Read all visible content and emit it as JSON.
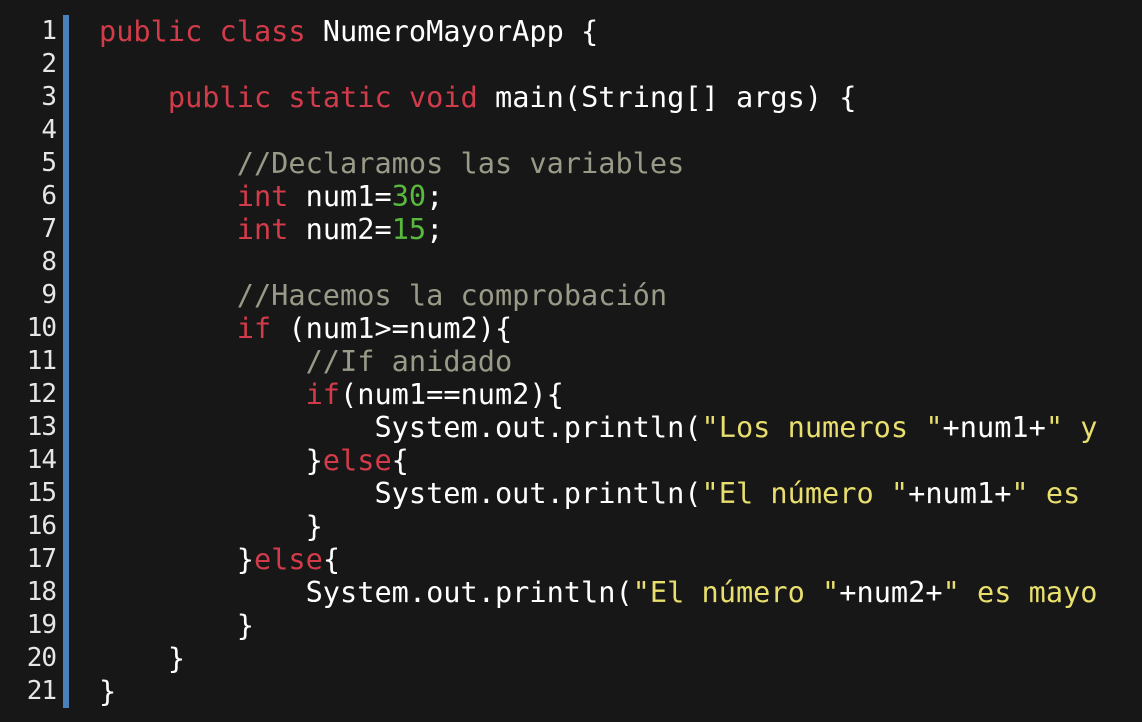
{
  "colors": {
    "background": "#171717",
    "keyword": "#d23b4a",
    "comment": "#9a9a88",
    "number": "#58b93d",
    "string": "#e8df6e",
    "plain": "#ffffff",
    "gutter_bar": "#4a7fb8"
  },
  "lines": [
    {
      "num": "1",
      "tokens": [
        {
          "t": "kw",
          "v": "public"
        },
        {
          "t": "pl",
          "v": " "
        },
        {
          "t": "kw",
          "v": "class"
        },
        {
          "t": "pl",
          "v": " NumeroMayorApp {"
        }
      ]
    },
    {
      "num": "2",
      "tokens": []
    },
    {
      "num": "3",
      "tokens": [
        {
          "t": "pl",
          "v": "    "
        },
        {
          "t": "kw",
          "v": "public"
        },
        {
          "t": "pl",
          "v": " "
        },
        {
          "t": "kw",
          "v": "static"
        },
        {
          "t": "pl",
          "v": " "
        },
        {
          "t": "kw",
          "v": "void"
        },
        {
          "t": "pl",
          "v": " main(String[] args) {"
        }
      ]
    },
    {
      "num": "4",
      "tokens": []
    },
    {
      "num": "5",
      "tokens": [
        {
          "t": "pl",
          "v": "        "
        },
        {
          "t": "cm",
          "v": "//Declaramos las variables"
        }
      ]
    },
    {
      "num": "6",
      "tokens": [
        {
          "t": "pl",
          "v": "        "
        },
        {
          "t": "kw",
          "v": "int"
        },
        {
          "t": "pl",
          "v": " num1="
        },
        {
          "t": "num",
          "v": "30"
        },
        {
          "t": "pl",
          "v": ";"
        }
      ]
    },
    {
      "num": "7",
      "tokens": [
        {
          "t": "pl",
          "v": "        "
        },
        {
          "t": "kw",
          "v": "int"
        },
        {
          "t": "pl",
          "v": " num2="
        },
        {
          "t": "num",
          "v": "15"
        },
        {
          "t": "pl",
          "v": ";"
        }
      ]
    },
    {
      "num": "8",
      "tokens": []
    },
    {
      "num": "9",
      "tokens": [
        {
          "t": "pl",
          "v": "        "
        },
        {
          "t": "cm",
          "v": "//Hacemos la comprobación"
        }
      ]
    },
    {
      "num": "10",
      "tokens": [
        {
          "t": "pl",
          "v": "        "
        },
        {
          "t": "kw",
          "v": "if"
        },
        {
          "t": "pl",
          "v": " (num1>=num2){"
        }
      ]
    },
    {
      "num": "11",
      "tokens": [
        {
          "t": "pl",
          "v": "            "
        },
        {
          "t": "cm",
          "v": "//If anidado"
        }
      ]
    },
    {
      "num": "12",
      "tokens": [
        {
          "t": "pl",
          "v": "            "
        },
        {
          "t": "kw",
          "v": "if"
        },
        {
          "t": "pl",
          "v": "(num1==num2){"
        }
      ]
    },
    {
      "num": "13",
      "tokens": [
        {
          "t": "pl",
          "v": "                System.out.println("
        },
        {
          "t": "str",
          "v": "\"Los numeros \""
        },
        {
          "t": "pl",
          "v": "+num1+"
        },
        {
          "t": "str",
          "v": "\" y"
        }
      ]
    },
    {
      "num": "14",
      "tokens": [
        {
          "t": "pl",
          "v": "            }"
        },
        {
          "t": "kw",
          "v": "else"
        },
        {
          "t": "pl",
          "v": "{"
        }
      ]
    },
    {
      "num": "15",
      "tokens": [
        {
          "t": "pl",
          "v": "                System.out.println("
        },
        {
          "t": "str",
          "v": "\"El número \""
        },
        {
          "t": "pl",
          "v": "+num1+"
        },
        {
          "t": "str",
          "v": "\" es"
        }
      ]
    },
    {
      "num": "16",
      "tokens": [
        {
          "t": "pl",
          "v": "            }"
        }
      ]
    },
    {
      "num": "17",
      "tokens": [
        {
          "t": "pl",
          "v": "        }"
        },
        {
          "t": "kw",
          "v": "else"
        },
        {
          "t": "pl",
          "v": "{"
        }
      ]
    },
    {
      "num": "18",
      "tokens": [
        {
          "t": "pl",
          "v": "            System.out.println("
        },
        {
          "t": "str",
          "v": "\"El número \""
        },
        {
          "t": "pl",
          "v": "+num2+"
        },
        {
          "t": "str",
          "v": "\" es mayo"
        }
      ]
    },
    {
      "num": "19",
      "tokens": [
        {
          "t": "pl",
          "v": "        }"
        }
      ]
    },
    {
      "num": "20",
      "tokens": [
        {
          "t": "pl",
          "v": "    }"
        }
      ]
    },
    {
      "num": "21",
      "tokens": [
        {
          "t": "pl",
          "v": "}"
        }
      ]
    }
  ]
}
